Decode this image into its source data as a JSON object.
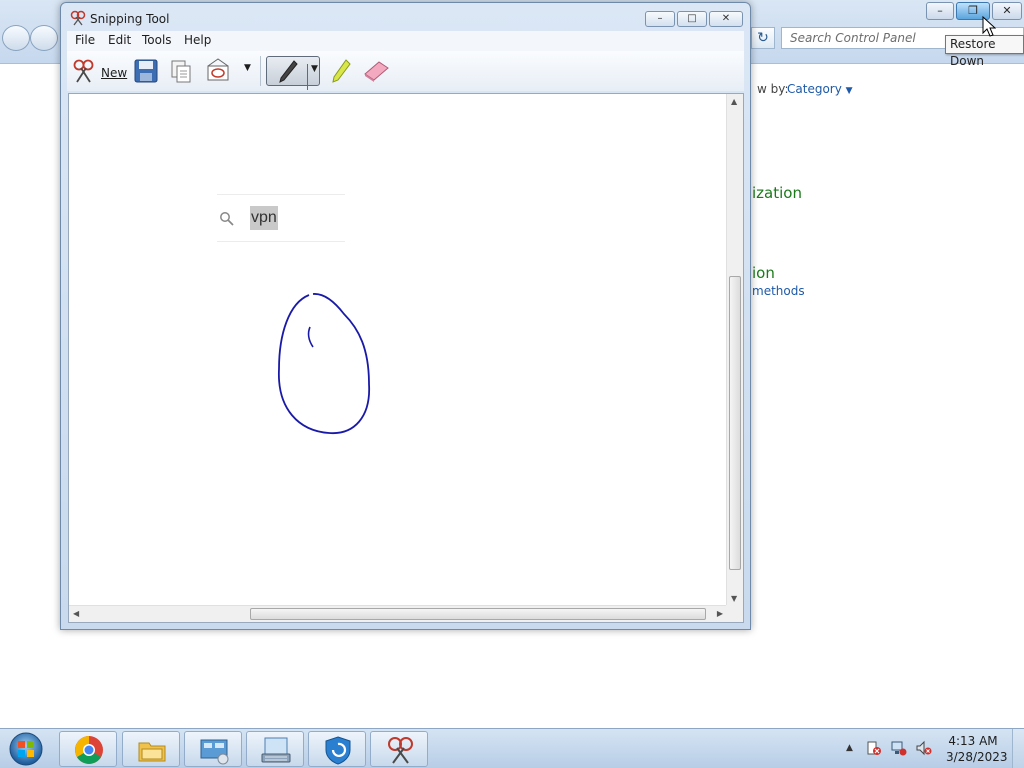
{
  "control_panel": {
    "search_placeholder": "Search Control Panel",
    "view_by_label": "w by:",
    "view_by_value": "Category",
    "link_1": "ization",
    "link_2": "ion",
    "link_3": "methods",
    "tooltip": "Restore Down"
  },
  "snipping_tool": {
    "title": "Snipping Tool",
    "menu": [
      "File",
      "Edit",
      "Tools",
      "Help"
    ],
    "toolbar": {
      "new_label": "New"
    },
    "snip_content": {
      "search_text": "vpn"
    }
  },
  "taskbar": {
    "apps": [
      "chrome-icon",
      "file-explorer-icon",
      "control-panel-icon",
      "keyboard-settings-icon",
      "defender-icon",
      "snipping-tool-icon"
    ],
    "clock_time": "4:13 AM",
    "clock_date": "3/28/2023"
  },
  "colors": {
    "ink": "#1a1aa8",
    "link_green": "#1a7a1a",
    "link_blue": "#1e5aa8"
  }
}
